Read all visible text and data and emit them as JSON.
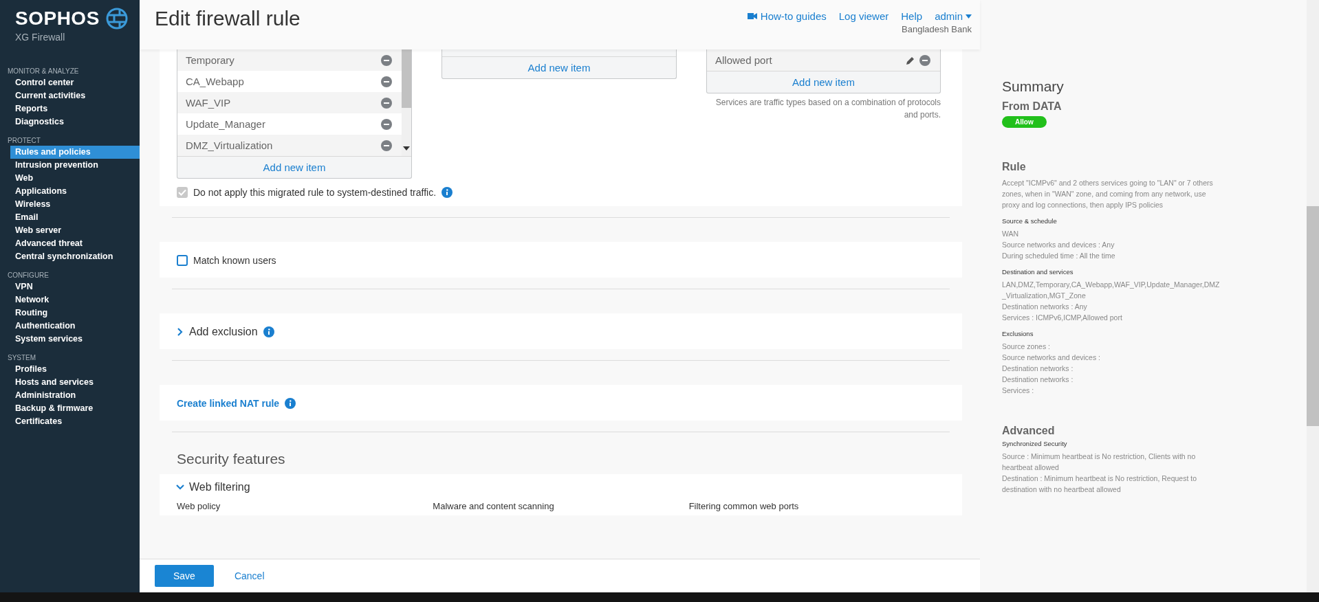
{
  "sidebar": {
    "brand": "SOPHOS",
    "product": "XG Firewall",
    "sections": [
      {
        "title": "MONITOR & ANALYZE",
        "items": [
          {
            "label": "Control center",
            "selected": false
          },
          {
            "label": "Current activities",
            "selected": false
          },
          {
            "label": "Reports",
            "selected": false
          },
          {
            "label": "Diagnostics",
            "selected": false
          }
        ]
      },
      {
        "title": "PROTECT",
        "items": [
          {
            "label": "Rules and policies",
            "selected": true
          },
          {
            "label": "Intrusion prevention",
            "selected": false
          },
          {
            "label": "Web",
            "selected": false
          },
          {
            "label": "Applications",
            "selected": false
          },
          {
            "label": "Wireless",
            "selected": false
          },
          {
            "label": "Email",
            "selected": false
          },
          {
            "label": "Web server",
            "selected": false
          },
          {
            "label": "Advanced threat",
            "selected": false
          },
          {
            "label": "Central synchronization",
            "selected": false
          }
        ]
      },
      {
        "title": "CONFIGURE",
        "items": [
          {
            "label": "VPN",
            "selected": false
          },
          {
            "label": "Network",
            "selected": false
          },
          {
            "label": "Routing",
            "selected": false
          },
          {
            "label": "Authentication",
            "selected": false
          },
          {
            "label": "System services",
            "selected": false
          }
        ]
      },
      {
        "title": "SYSTEM",
        "items": [
          {
            "label": "Profiles",
            "selected": false
          },
          {
            "label": "Hosts and services",
            "selected": false
          },
          {
            "label": "Administration",
            "selected": false
          },
          {
            "label": "Backup & firmware",
            "selected": false
          },
          {
            "label": "Certificates",
            "selected": false
          }
        ]
      }
    ]
  },
  "header": {
    "title": "Edit firewall rule",
    "links": [
      "How-to guides",
      "Log viewer",
      "Help"
    ],
    "user": "admin",
    "organization": "Bangladesh Bank"
  },
  "zones_list": {
    "items": [
      {
        "label": "Temporary",
        "editable": false
      },
      {
        "label": "CA_Webapp",
        "editable": false
      },
      {
        "label": "WAF_VIP",
        "editable": false
      },
      {
        "label": "Update_Manager",
        "editable": false
      },
      {
        "label": "DMZ_Virtualization",
        "editable": false
      }
    ],
    "add": "Add new item"
  },
  "networks_list": {
    "add": "Add new item"
  },
  "services_list": {
    "items": [
      {
        "label": "Allowed port",
        "editable": true
      }
    ],
    "add": "Add new item",
    "hint": "Services are traffic types based on a combination of protocols and ports."
  },
  "system_traffic": {
    "label": "Do not apply this migrated rule to system-destined traffic.",
    "checked": true,
    "disabled": true
  },
  "match_users": {
    "label": "Match known users",
    "checked": false,
    "disabled": false
  },
  "exclusion": {
    "label": "Add exclusion",
    "expanded": false
  },
  "nat_link": "Create linked NAT rule",
  "security": {
    "title": "Security features",
    "section": "Web filtering",
    "expanded": true,
    "columns": [
      "Web policy",
      "Malware and content scanning",
      "Filtering common web ports"
    ]
  },
  "footer": {
    "save": "Save",
    "cancel": "Cancel"
  },
  "summary": {
    "title": "Summary",
    "rule_name": "From DATA",
    "action": "Allow",
    "rule_title": "Rule",
    "rule_text": "Accept \"ICMPv6\" and 2 others services going to \"LAN\" or 7 others zones, when in \"WAN\" zone, and coming from any network, use proxy and log connections, then apply IPS policies",
    "groups": [
      {
        "title": "Source & schedule",
        "lines": [
          "WAN",
          "Source networks and devices : Any",
          "During scheduled time : All the time"
        ]
      },
      {
        "title": "Destination and services",
        "lines": [
          "LAN,DMZ,Temporary,CA_Webapp,WAF_VIP,Update_Manager,DMZ_Virtualization,MGT_Zone",
          "Destination networks : Any",
          "Services : ICMPv6,ICMP,Allowed port"
        ]
      },
      {
        "title": "Exclusions",
        "lines": [
          "Source zones :",
          "Source networks and devices :",
          "Destination networks :",
          "Destination networks :",
          "Services :"
        ]
      }
    ],
    "advanced_title": "Advanced",
    "advanced_groups": [
      {
        "title": "Synchronized Security",
        "lines": [
          "Source : Minimum heartbeat is No restriction, Clients with no heartbeat allowed",
          "Destination : Minimum heartbeat is No restriction, Request to destination with no heartbeat allowed"
        ]
      }
    ]
  }
}
